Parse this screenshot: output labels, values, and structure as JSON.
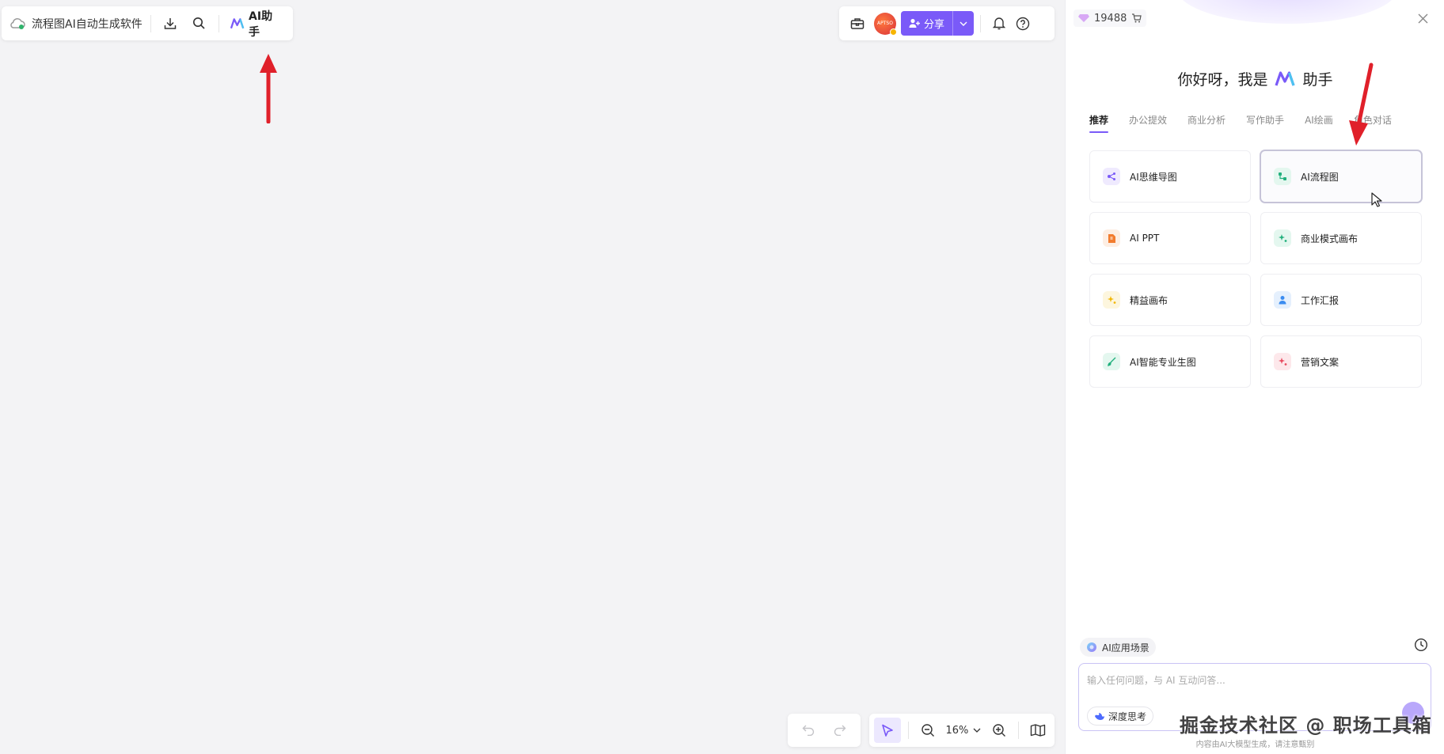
{
  "toolbar_left": {
    "doc_title": "流程图AI自动生成软件",
    "ai_assistant_label": "AI助手"
  },
  "toolbar_right": {
    "avatar_text": "APTSO",
    "share_label": "分享"
  },
  "bottom_toolbar": {
    "zoom_value": "16%"
  },
  "panel": {
    "credits": "19488",
    "greeting_prefix": "你好呀，我是",
    "greeting_suffix": "助手",
    "tabs": [
      {
        "label": "推荐",
        "active": true
      },
      {
        "label": "办公提效"
      },
      {
        "label": "商业分析"
      },
      {
        "label": "写作助手"
      },
      {
        "label": "AI绘画"
      },
      {
        "label": "角色对话"
      }
    ],
    "tiles": [
      {
        "label": "AI思维导图",
        "icon": "mindmap-icon",
        "color": "#7a5af8",
        "bg": "#efeafe"
      },
      {
        "label": "AI流程图",
        "icon": "flowchart-icon",
        "color": "#22b07d",
        "bg": "#e4f7ef"
      },
      {
        "label": "AI PPT",
        "icon": "ppt-icon",
        "color": "#f27c2e",
        "bg": "#fdeee3"
      },
      {
        "label": "商业模式画布",
        "icon": "sparkle-icon",
        "color": "#22b07d",
        "bg": "#e4f7ef"
      },
      {
        "label": "精益画布",
        "icon": "sparkle-icon",
        "color": "#f2b705",
        "bg": "#fdf6de"
      },
      {
        "label": "工作汇报",
        "icon": "person-icon",
        "color": "#3b8cf0",
        "bg": "#e5f0fd"
      },
      {
        "label": "AI智能专业生图",
        "icon": "brush-icon",
        "color": "#22b07d",
        "bg": "#e4f7ef"
      },
      {
        "label": "营销文案",
        "icon": "sparkle-icon",
        "color": "#e84a5f",
        "bg": "#fde8eb"
      }
    ],
    "scene_label": "AI应用场景",
    "input_placeholder": "输入任何问题，与 AI 互动问答...",
    "deep_think_label": "深度思考",
    "disclaimer": "内容由AI大模型生成，请注意甄别"
  },
  "watermark": "掘金技术社区 @ 职场工具箱",
  "colors": {
    "accent": "#7a5af8",
    "annotation_arrow": "#e0202a",
    "canvas_bg": "#f3f3f5"
  }
}
